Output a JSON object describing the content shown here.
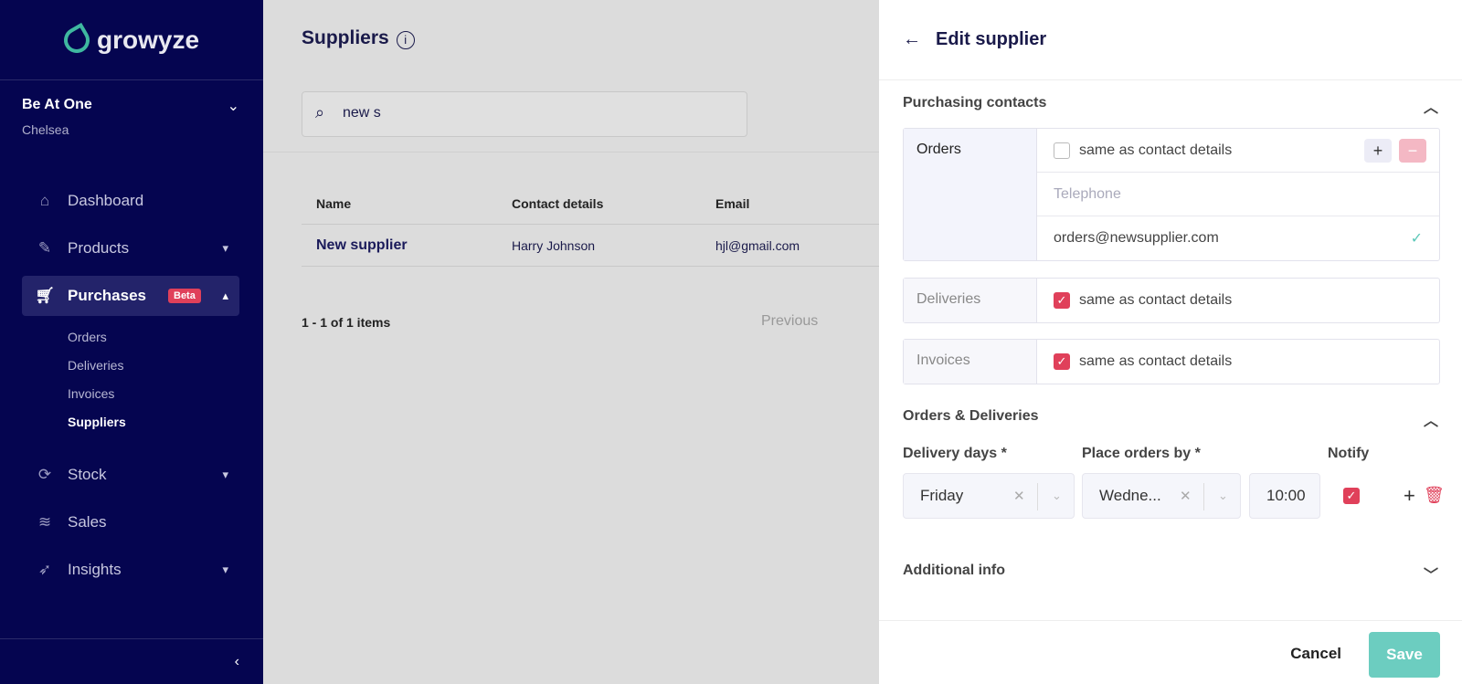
{
  "brand": {
    "name": "growyze",
    "accent": "#3fb8a0"
  },
  "venue": {
    "name": "Be At One",
    "location": "Chelsea"
  },
  "nav": [
    {
      "label": "Dashboard",
      "icon": "home-icon"
    },
    {
      "label": "Products",
      "icon": "bottle-icon"
    },
    {
      "label": "Purchases",
      "icon": "cart-icon",
      "badge": "Beta"
    },
    {
      "label": "Stock",
      "icon": "refresh-icon"
    },
    {
      "label": "Sales",
      "icon": "coins-icon"
    },
    {
      "label": "Insights",
      "icon": "rocket-icon"
    }
  ],
  "purchases_sub": [
    "Orders",
    "Deliveries",
    "Invoices",
    "Suppliers"
  ],
  "main": {
    "title": "Suppliers",
    "search_value": "new s",
    "columns": [
      "Name",
      "Contact details",
      "Email"
    ],
    "rows": [
      {
        "name": "New supplier",
        "contact": "Harry Johnson",
        "email": "hjl@gmail.com"
      }
    ],
    "count": "1 - 1 of 1 items",
    "previous": "Previous"
  },
  "panel": {
    "title": "Edit supplier",
    "purchasing_contacts": {
      "title": "Purchasing contacts",
      "orders": {
        "label": "Orders",
        "same": "same as contact details",
        "same_checked": false,
        "telephone_placeholder": "Telephone",
        "email": "orders@newsupplier.com"
      },
      "deliveries": {
        "label": "Deliveries",
        "same": "same as contact details",
        "same_checked": true
      },
      "invoices": {
        "label": "Invoices",
        "same": "same as contact details",
        "same_checked": true
      }
    },
    "orders_deliveries": {
      "title": "Orders & Deliveries",
      "delivery_days_label": "Delivery days *",
      "place_orders_label": "Place orders by *",
      "notify_label": "Notify",
      "delivery_day": "Friday",
      "place_orders_day": "Wedne...",
      "time": "10:00",
      "notify": true
    },
    "additional_info": "Additional info",
    "cancel": "Cancel",
    "save": "Save"
  }
}
